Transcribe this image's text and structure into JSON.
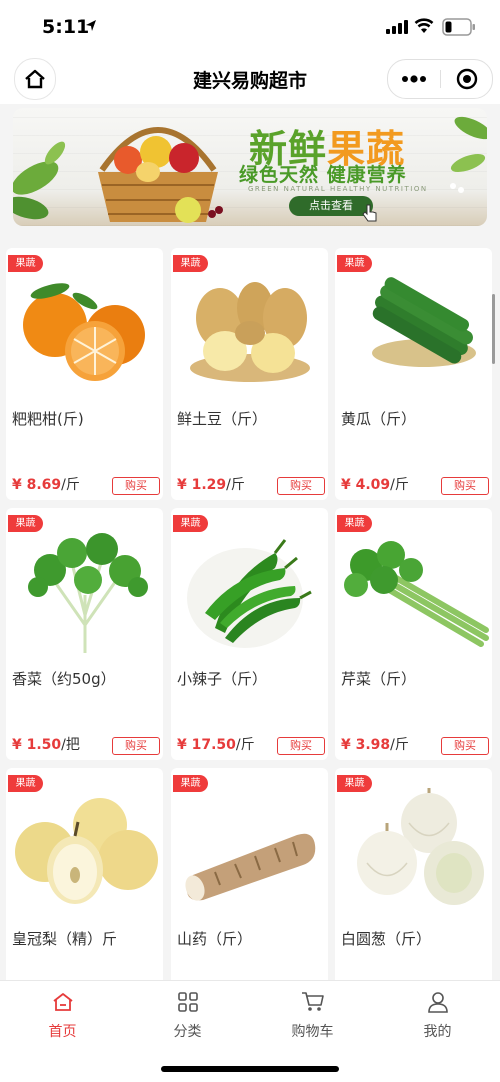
{
  "status_bar": {
    "time": "5:11"
  },
  "nav": {
    "title": "建兴易购超市"
  },
  "banner": {
    "title_part1": "新鲜",
    "title_part2": "果蔬",
    "subtitle": "绿色天然 健康营养",
    "english": "GREEN NATURAL HEALTHY NUTRITION",
    "button_label": "点击查看"
  },
  "products": [
    {
      "tag": "果蔬",
      "name": "粑粑柑(斤)",
      "price": "¥ 8.69",
      "unit": "/斤",
      "buy_label": "购买",
      "icon": "tangerine-icon"
    },
    {
      "tag": "果蔬",
      "name": "鲜土豆（斤）",
      "price": "¥ 1.29",
      "unit": "/斤",
      "buy_label": "购买",
      "icon": "potato-icon"
    },
    {
      "tag": "果蔬",
      "name": "黄瓜（斤）",
      "price": "¥ 4.09",
      "unit": "/斤",
      "buy_label": "购买",
      "icon": "cucumber-icon"
    },
    {
      "tag": "果蔬",
      "name": "香菜（约50g）",
      "price": "¥ 1.50",
      "unit": "/把",
      "buy_label": "购买",
      "icon": "coriander-icon"
    },
    {
      "tag": "果蔬",
      "name": "小辣子（斤）",
      "price": "¥ 17.50",
      "unit": "/斤",
      "buy_label": "购买",
      "icon": "pepper-icon"
    },
    {
      "tag": "果蔬",
      "name": "芹菜（斤）",
      "price": "¥ 3.98",
      "unit": "/斤",
      "buy_label": "购买",
      "icon": "celery-icon"
    },
    {
      "tag": "果蔬",
      "name": "皇冠梨（精）斤",
      "icon": "pear-icon"
    },
    {
      "tag": "果蔬",
      "name": "山药（斤）",
      "icon": "yam-icon"
    },
    {
      "tag": "果蔬",
      "name": "白圆葱（斤）",
      "icon": "onion-icon"
    }
  ],
  "tabs": [
    {
      "label": "首页",
      "icon": "home-icon",
      "active": true
    },
    {
      "label": "分类",
      "icon": "category-icon",
      "active": false
    },
    {
      "label": "购物车",
      "icon": "cart-icon",
      "active": false
    },
    {
      "label": "我的",
      "icon": "user-icon",
      "active": false
    }
  ],
  "colors": {
    "accent": "#e63b3b",
    "tag": "#ef3b3b",
    "banner_green": "#5aa22a",
    "banner_orange": "#f29a1f"
  }
}
